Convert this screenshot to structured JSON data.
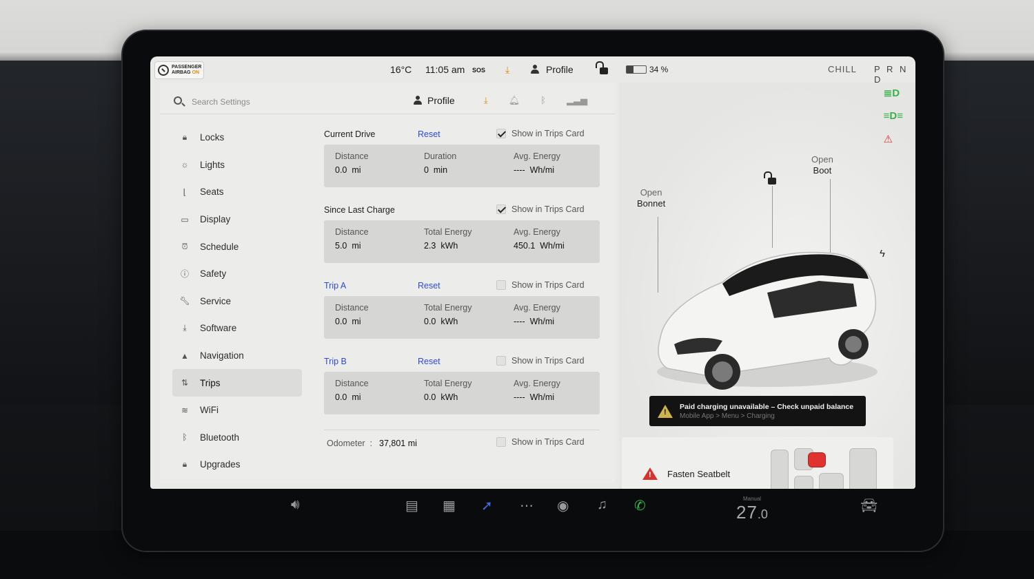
{
  "status_bar": {
    "airbag_line1": "PASSENGER",
    "airbag_line2": "AIRBAG",
    "airbag_state": "ON",
    "temperature": "16°C",
    "time": "11:05 am",
    "sos": "SOS",
    "profile": "Profile",
    "battery_percent": "34 %",
    "battery_level": 0.34,
    "drive_mode": "CHILL",
    "gear": "P R N D"
  },
  "search": {
    "placeholder": "Search Settings"
  },
  "header": {
    "profile": "Profile"
  },
  "nav": {
    "items": [
      {
        "label": "Locks",
        "icon": "lock-icon"
      },
      {
        "label": "Lights",
        "icon": "light-icon"
      },
      {
        "label": "Seats",
        "icon": "seat-icon"
      },
      {
        "label": "Display",
        "icon": "display-icon"
      },
      {
        "label": "Schedule",
        "icon": "clock-icon"
      },
      {
        "label": "Safety",
        "icon": "safety-icon"
      },
      {
        "label": "Service",
        "icon": "wrench-icon"
      },
      {
        "label": "Software",
        "icon": "download-icon"
      },
      {
        "label": "Navigation",
        "icon": "navigation-icon"
      },
      {
        "label": "Trips",
        "icon": "trips-icon"
      },
      {
        "label": "WiFi",
        "icon": "wifi-icon"
      },
      {
        "label": "Bluetooth",
        "icon": "bluetooth-icon"
      },
      {
        "label": "Upgrades",
        "icon": "upgrades-icon"
      }
    ],
    "active": "Trips"
  },
  "trips": {
    "show_label": "Show in Trips Card",
    "reset_label": "Reset",
    "sections": [
      {
        "title": "Current Drive",
        "has_reset": true,
        "show_checked": true,
        "stats": [
          {
            "label": "Distance",
            "value": "0.0  mi"
          },
          {
            "label": "Duration",
            "value": "0  min"
          },
          {
            "label": "Avg. Energy",
            "value": "----  Wh/mi"
          }
        ]
      },
      {
        "title": "Since Last Charge",
        "has_reset": false,
        "show_checked": true,
        "stats": [
          {
            "label": "Distance",
            "value": "5.0  mi"
          },
          {
            "label": "Total Energy",
            "value": "2.3  kWh"
          },
          {
            "label": "Avg. Energy",
            "value": "450.1  Wh/mi"
          }
        ]
      },
      {
        "title": "Trip A",
        "has_reset": true,
        "show_checked": false,
        "stats": [
          {
            "label": "Distance",
            "value": "0.0  mi"
          },
          {
            "label": "Total Energy",
            "value": "0.0  kWh"
          },
          {
            "label": "Avg. Energy",
            "value": "----  Wh/mi"
          }
        ]
      },
      {
        "title": "Trip B",
        "has_reset": true,
        "show_checked": false,
        "stats": [
          {
            "label": "Distance",
            "value": "0.0  mi"
          },
          {
            "label": "Total Energy",
            "value": "0.0  kWh"
          },
          {
            "label": "Avg. Energy",
            "value": "----  Wh/mi"
          }
        ]
      }
    ],
    "odometer_label": "Odometer  :",
    "odometer_value": "37,801 mi"
  },
  "car": {
    "open_bonnet_1": "Open",
    "open_bonnet_2": "Bonnet",
    "open_boot_1": "Open",
    "open_boot_2": "Boot",
    "alert_title": "Paid charging unavailable – Check unpaid balance",
    "alert_sub": "Mobile App > Menu > Charging",
    "seatbelt_label": "Fasten Seatbelt"
  },
  "taskbar": {
    "climate_mode": "Manual",
    "temperature": "27",
    "temperature_decimal": ".0"
  },
  "colors": {
    "link_blue": "#2d4ad6",
    "indicator_green": "#37b34a",
    "warning_red": "#e0322f",
    "download_orange": "#e08a00"
  }
}
